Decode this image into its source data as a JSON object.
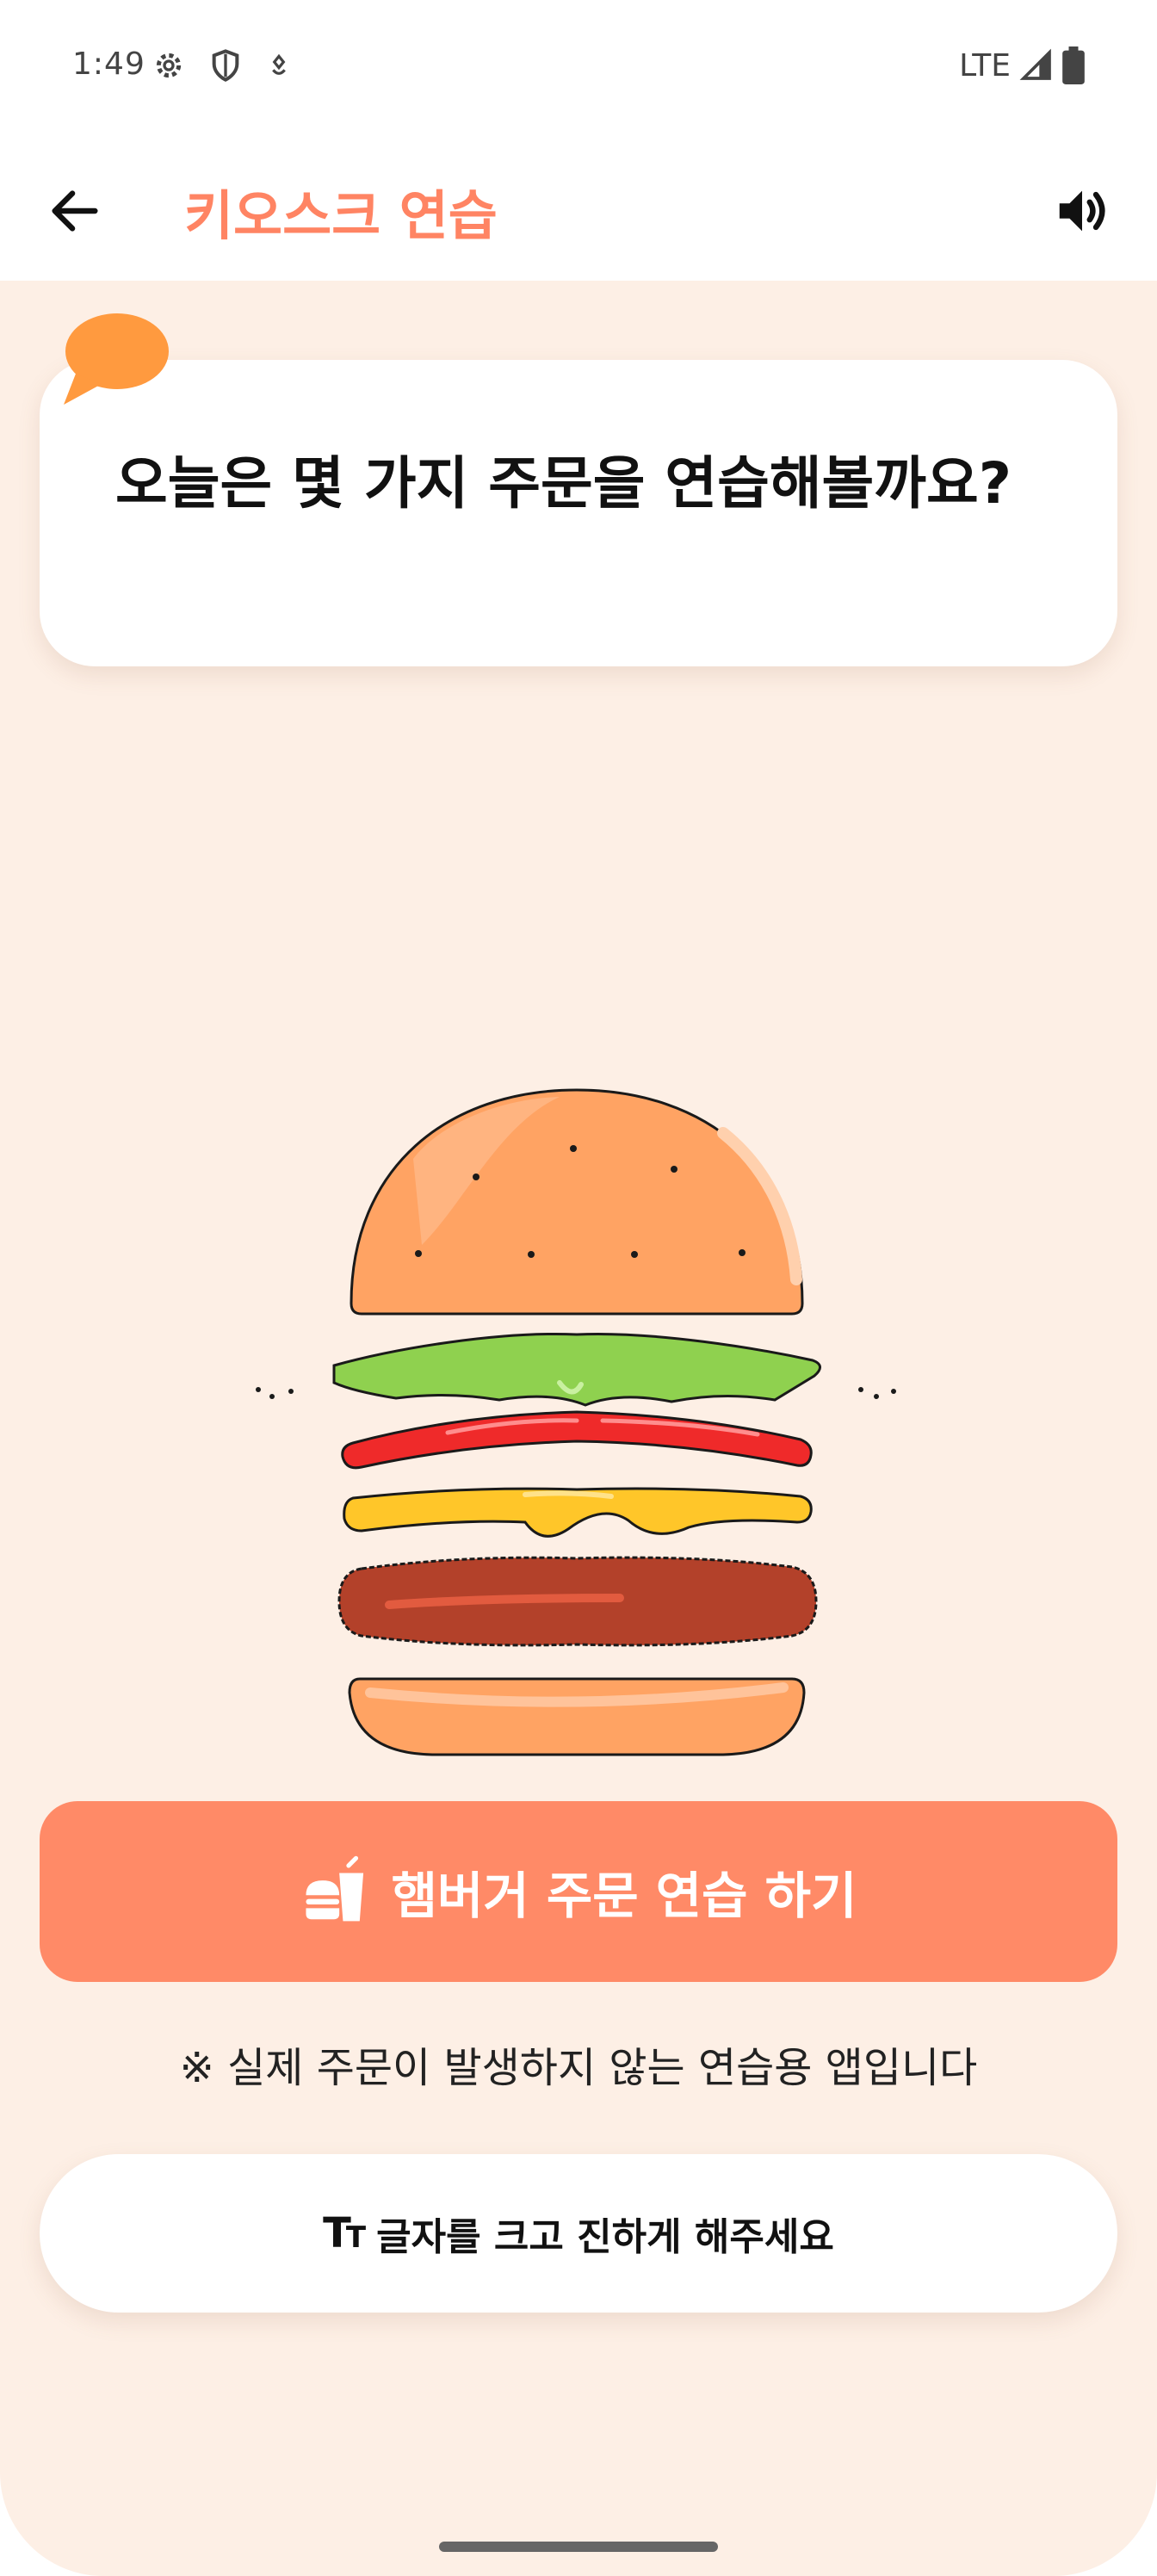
{
  "status_bar": {
    "time": "1:49",
    "network": "LTE",
    "icons": [
      "gear-icon",
      "shield-icon",
      "location-icon",
      "signal-icon",
      "battery-icon"
    ]
  },
  "app_bar": {
    "back_icon": "arrow-left-icon",
    "title": "키오스크 연습",
    "speaker_icon": "speaker-icon"
  },
  "question": {
    "text": "오늘은 몇 가지 주문을 연습해볼까요?"
  },
  "illustration": "burger-illustration",
  "primary_action": {
    "icon": "burger-drink-icon",
    "label": "햄버거 주문 연습 하기"
  },
  "notice": "※ 실제 주문이 발생하지 않는 연습용 앱입니다",
  "secondary_action": {
    "icon": "text-size-icon",
    "label": "글자를 크고 진하게 해주세요"
  },
  "colors": {
    "accent": "#ff8463",
    "button": "#ff8a67",
    "background": "#fdefe5",
    "bubble": "#ff9a3f"
  }
}
